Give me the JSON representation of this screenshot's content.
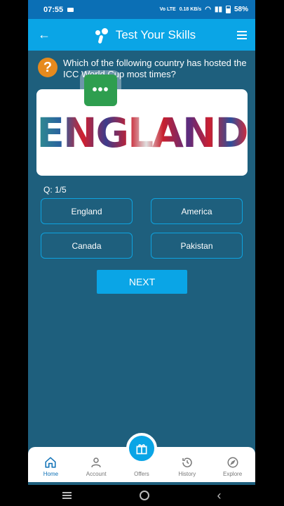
{
  "status_bar": {
    "time": "07:55",
    "network": "Vo LTE",
    "speed": "0.18 KB/s",
    "battery": "58%"
  },
  "app_bar": {
    "title": "Test Your Skills"
  },
  "question": {
    "text": "Which of the following country has hosted the ICC World Cup most times?",
    "image_word": "ENGLAND",
    "counter": "Q: 1/5"
  },
  "options": [
    {
      "label": "England"
    },
    {
      "label": "America"
    },
    {
      "label": "Canada"
    },
    {
      "label": "Pakistan"
    }
  ],
  "next_label": "NEXT",
  "nav": {
    "items": [
      {
        "label": "Home",
        "icon": "home-icon",
        "active": true
      },
      {
        "label": "Account",
        "icon": "account-icon",
        "active": false
      },
      {
        "label": "Offers",
        "icon": "gift-icon",
        "active": false
      },
      {
        "label": "History",
        "icon": "history-icon",
        "active": false
      },
      {
        "label": "Explore",
        "icon": "compass-icon",
        "active": false
      }
    ]
  },
  "colors": {
    "primary": "#0aa5e6",
    "background": "#1e5f7d",
    "help_icon": "#e68a1e",
    "chat_bubble": "#2e9e4f"
  }
}
